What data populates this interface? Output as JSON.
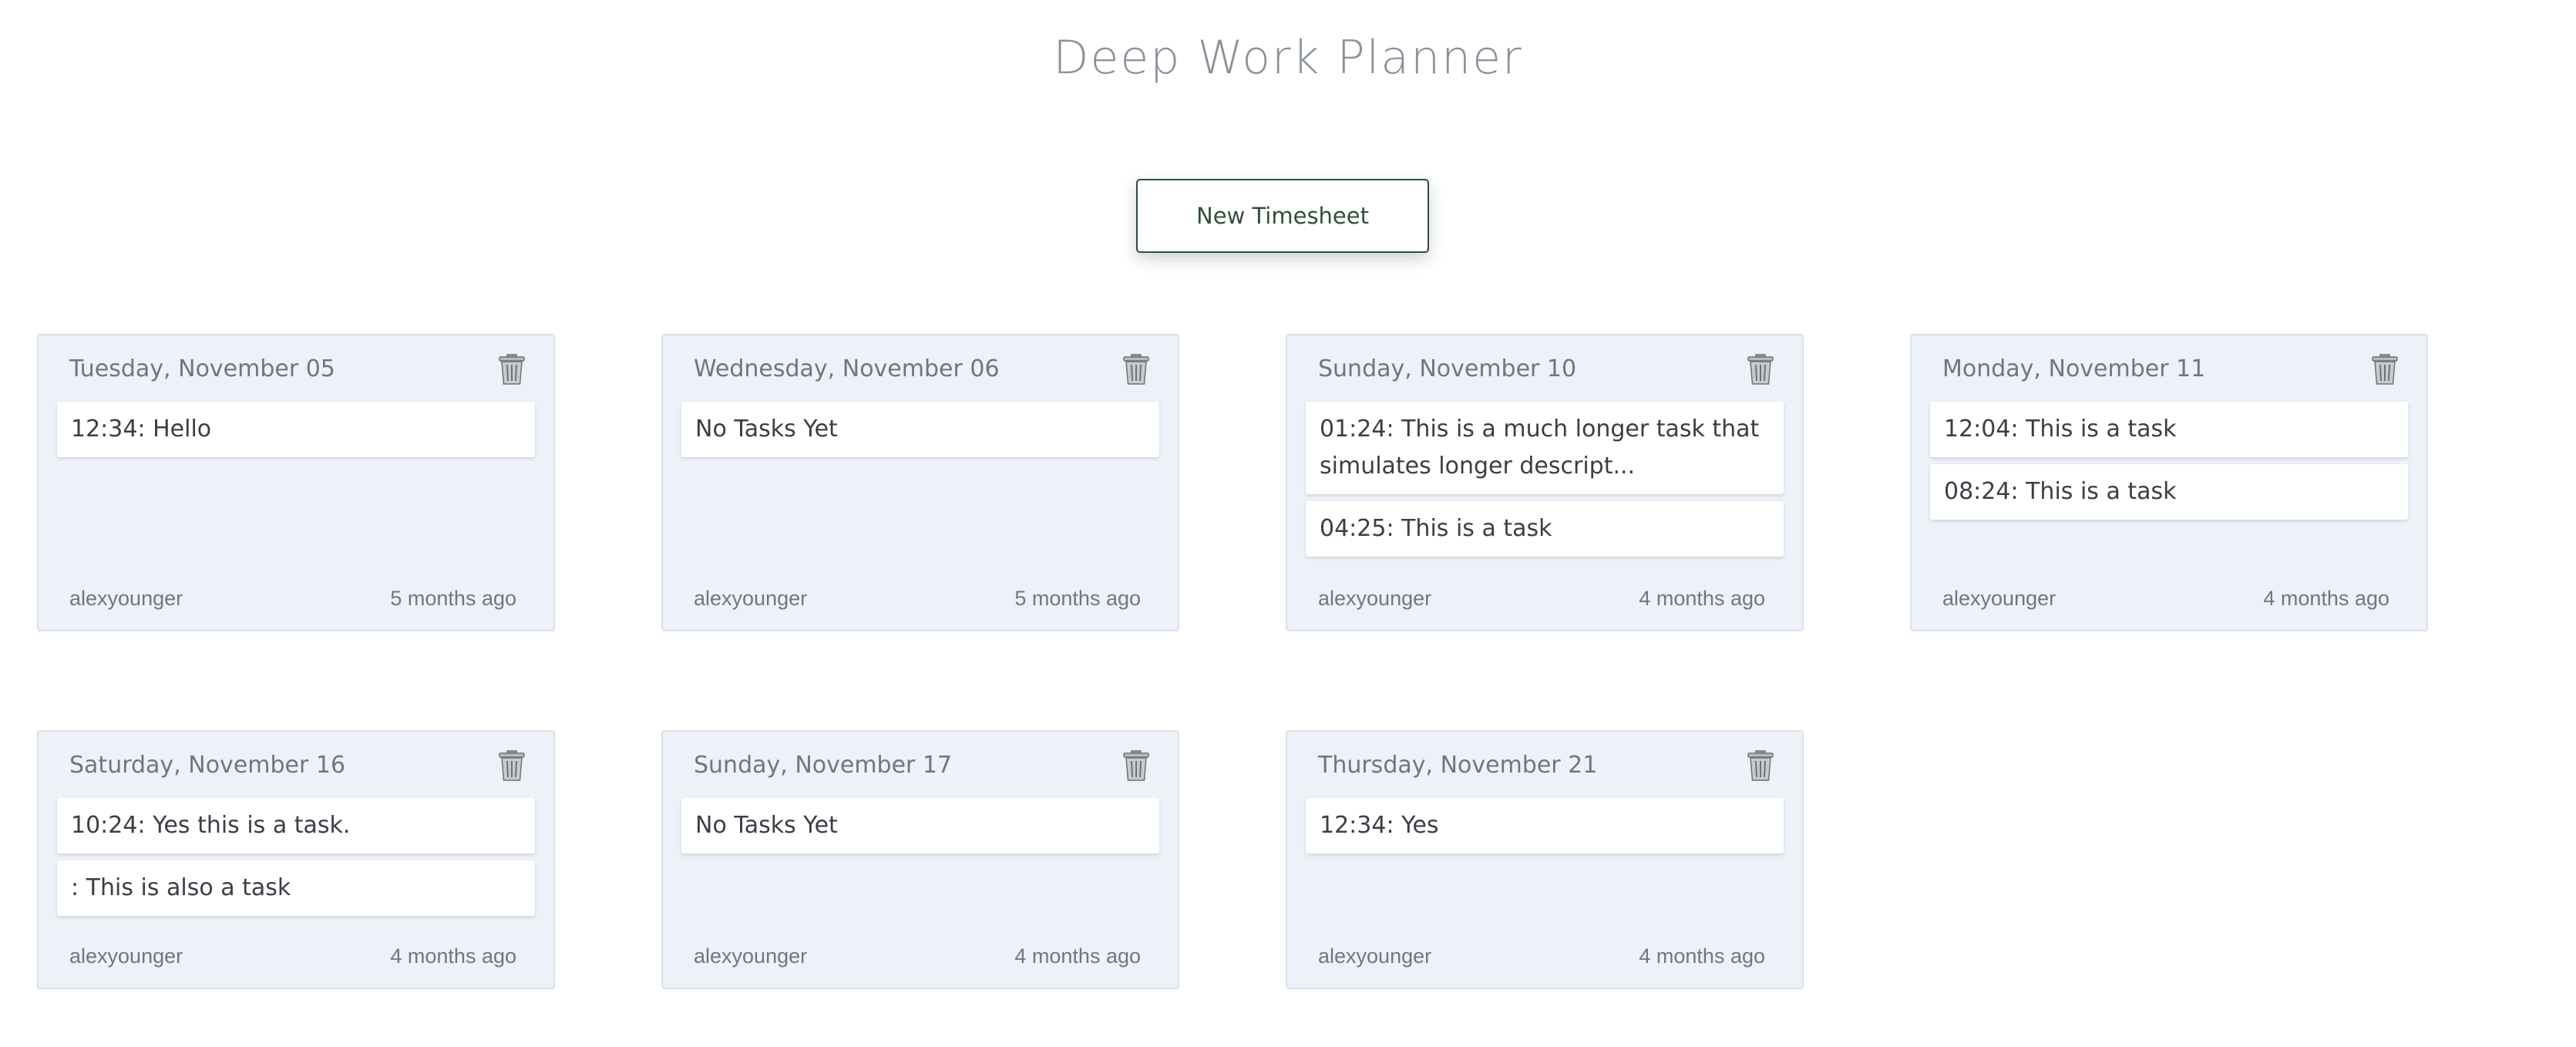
{
  "header": {
    "title": "Deep Work Planner"
  },
  "actions": {
    "new_timesheet_label": "New Timesheet"
  },
  "timesheets": [
    {
      "date": "Tuesday, November 05",
      "tasks": [
        "12:34: Hello"
      ],
      "author": "alexyounger",
      "age": "5 months ago"
    },
    {
      "date": "Wednesday, November 06",
      "tasks": [
        "No Tasks Yet"
      ],
      "author": "alexyounger",
      "age": "5 months ago"
    },
    {
      "date": "Sunday, November 10",
      "tasks": [
        "01:24: This is a much longer task that simulates longer descript...",
        "04:25: This is a task"
      ],
      "author": "alexyounger",
      "age": "4 months ago"
    },
    {
      "date": "Monday, November 11",
      "tasks": [
        "12:04: This is a task",
        "08:24: This is a task"
      ],
      "author": "alexyounger",
      "age": "4 months ago"
    },
    {
      "date": "Saturday, November 16",
      "tasks": [
        "10:24: Yes this is a task.",
        ": This is also a task"
      ],
      "author": "alexyounger",
      "age": "4 months ago"
    },
    {
      "date": "Sunday, November 17",
      "tasks": [
        "No Tasks Yet"
      ],
      "author": "alexyounger",
      "age": "4 months ago"
    },
    {
      "date": "Thursday, November 21",
      "tasks": [
        "12:34: Yes"
      ],
      "author": "alexyounger",
      "age": "4 months ago"
    }
  ],
  "icons": {
    "delete": "trash-icon"
  },
  "colors": {
    "accent": "#2f4f3a",
    "card_bg": "#edf1f8",
    "muted_text": "#6d7782"
  }
}
